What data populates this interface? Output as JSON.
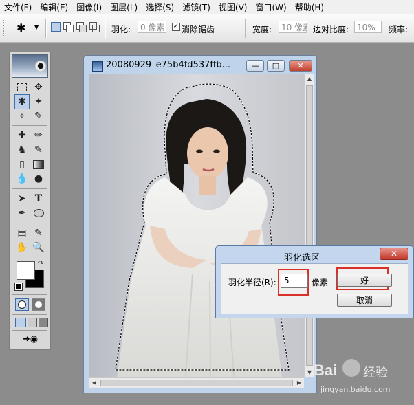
{
  "menubar": {
    "items": [
      "文件(F)",
      "编辑(E)",
      "图像(I)",
      "图层(L)",
      "选择(S)",
      "滤镜(T)",
      "视图(V)",
      "窗口(W)",
      "帮助(H)"
    ]
  },
  "options": {
    "feather_label": "羽化:",
    "feather_value": "0 像素",
    "antialias_label": "消除锯齿",
    "antialias_checked": true,
    "width_label": "宽度:",
    "width_value": "10 像素",
    "contrast_label": "边对比度:",
    "contrast_value": "10%",
    "freq_label": "频率:"
  },
  "document": {
    "title": "20080929_e75b4fd537ffb..."
  },
  "dialog": {
    "title": "羽化选区",
    "radius_label": "羽化半径(R):",
    "radius_value": "5",
    "unit": "像素",
    "ok_label": "好",
    "cancel_label": "取消"
  },
  "watermark": {
    "brand": "Bai",
    "brand_suffix": "经验",
    "url": "jingyan.baidu.com"
  },
  "colors": {
    "highlight": "#d9302a",
    "dialog_frame": "#c3d6ee",
    "window_frame": "#bfd3ea",
    "workspace": "#8c8c8c"
  }
}
